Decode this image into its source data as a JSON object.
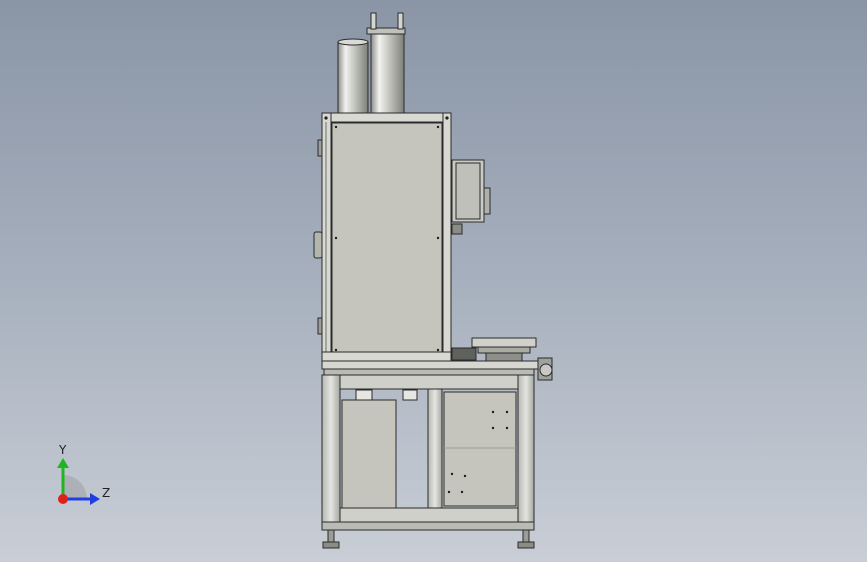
{
  "view": {
    "background_top": "#8a95a6",
    "background_bottom": "#c9ced6",
    "metal_color": "#c9cbc4",
    "panel_color": "#c6c5bd",
    "edge_color": "#2b2b2b"
  },
  "triad": {
    "x_axis_color": "#e0201a",
    "y_axis_color": "#1fb51f",
    "z_axis_color": "#1f3fe0",
    "y_label": "Y",
    "z_label": "Z"
  }
}
